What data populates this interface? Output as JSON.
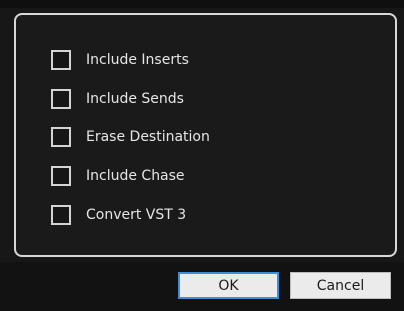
{
  "dialog": {
    "options": [
      {
        "label": "Include Inserts",
        "checked": false
      },
      {
        "label": "Include Sends",
        "checked": false
      },
      {
        "label": "Erase Destination",
        "checked": false
      },
      {
        "label": "Include Chase",
        "checked": false
      },
      {
        "label": "Convert VST 3",
        "checked": false
      }
    ],
    "buttons": {
      "ok_label": "OK",
      "cancel_label": "Cancel"
    }
  },
  "colors": {
    "background": "#171717",
    "panel_border": "#d8d8d8",
    "default_button_border": "#3a8fd8"
  }
}
